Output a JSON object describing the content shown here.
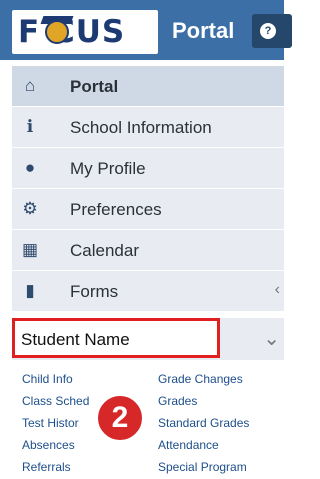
{
  "header": {
    "logo_text": "F CUS",
    "title": "Portal",
    "help_icon": "?"
  },
  "menu": {
    "items": [
      {
        "label": "Portal",
        "icon": "home-icon",
        "glyph": "🏠",
        "bold": true
      },
      {
        "label": "School Information",
        "icon": "info-icon",
        "glyph": "ℹ"
      },
      {
        "label": "My Profile",
        "icon": "user-icon",
        "glyph": "👤"
      },
      {
        "label": "Preferences",
        "icon": "gear-icon",
        "glyph": "⚙"
      },
      {
        "label": "Calendar",
        "icon": "calendar-icon",
        "glyph": "📅"
      },
      {
        "label": "Forms",
        "icon": "file-icon",
        "glyph": "📄"
      }
    ]
  },
  "student": {
    "label": "Student Name"
  },
  "sublinks": {
    "left": [
      "Child Info",
      "Class Sched",
      "Test Histor",
      "Absences",
      "Referrals"
    ],
    "right": [
      "Grade Changes",
      "Grades",
      "Standard Grades",
      "Attendance",
      "Special Program"
    ]
  },
  "badge": {
    "label": "2"
  },
  "colors": {
    "header": "#3b6fa5",
    "highlight": "#e02020",
    "badge": "#d62828"
  }
}
